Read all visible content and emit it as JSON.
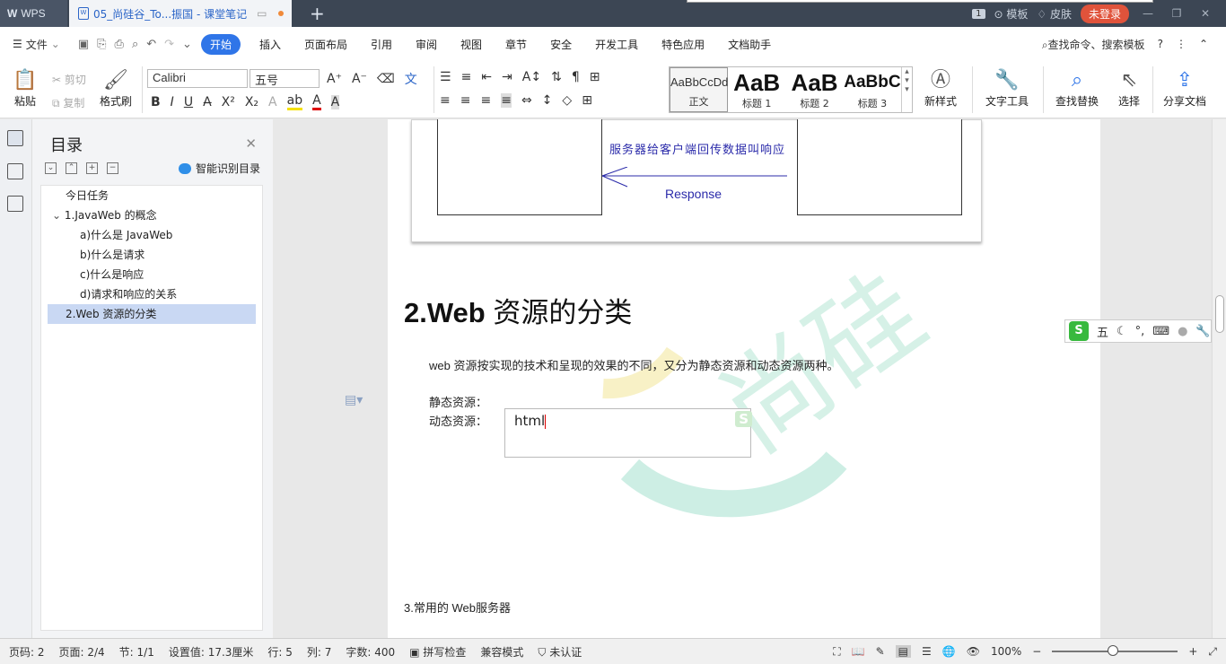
{
  "titlebar": {
    "app": "WPS",
    "doc_tab": "05_尚硅谷_To...振国 - 课堂笔记",
    "new_tab": "+",
    "page_badge": "1",
    "template": "模板",
    "skin": "皮肤",
    "login": "未登录"
  },
  "menubar": {
    "file": "文件",
    "active": "开始",
    "items": [
      "插入",
      "页面布局",
      "引用",
      "审阅",
      "视图",
      "章节",
      "安全",
      "开发工具",
      "特色应用",
      "文档助手"
    ],
    "search": "查找命令、搜索模板"
  },
  "toolbar": {
    "paste": "粘贴",
    "cut": "剪切",
    "copy": "复制",
    "format_painter": "格式刷",
    "font": "Calibri",
    "size": "五号",
    "styles": [
      {
        "preview": "AaBbCcDd",
        "label": "正文"
      },
      {
        "preview": "AaB",
        "label": "标题 1"
      },
      {
        "preview": "AaB",
        "label": "标题 2"
      },
      {
        "preview": "AaBbC",
        "label": "标题 3"
      }
    ],
    "new_style": "新样式",
    "text_tools": "文字工具",
    "find_replace": "查找替换",
    "select": "选择",
    "share": "分享文档"
  },
  "toc_panel": {
    "title": "目录",
    "smart": "智能识别目录",
    "items": [
      {
        "label": "今日任务",
        "level": 1
      },
      {
        "label": "1.JavaWeb 的概念",
        "level": 1
      },
      {
        "label": "a)什么是 JavaWeb",
        "level": 2
      },
      {
        "label": "b)什么是请求",
        "level": 2
      },
      {
        "label": "c)什么是响应",
        "level": 2
      },
      {
        "label": "d)请求和响应的关系",
        "level": 2
      },
      {
        "label": "2.Web 资源的分类",
        "level": 1
      }
    ]
  },
  "document": {
    "diagram_text": "服务器给客户端回传数据叫响应",
    "diagram_label": "Response",
    "heading_num": "2.Web",
    "heading_rest": " 资源的分类",
    "para1": "web 资源按实现的技术和呈现的效果的不同，又分为静态资源和动态资源两种。",
    "static_label": "静态资源：",
    "dynamic_label": "动态资源：",
    "textbox": "html",
    "next_heading": "3.常用的 Web服务器"
  },
  "ime": {
    "mode": "五"
  },
  "status": {
    "page_num": "页码: 2",
    "pages": "页面: 2/4",
    "section": "节: 1/1",
    "setting": "设置值: 17.3厘米",
    "row": "行: 5",
    "col": "列: 7",
    "words": "字数: 400",
    "spell": "拼写检查",
    "compat": "兼容模式",
    "cert": "未认证",
    "zoom": "100%"
  }
}
